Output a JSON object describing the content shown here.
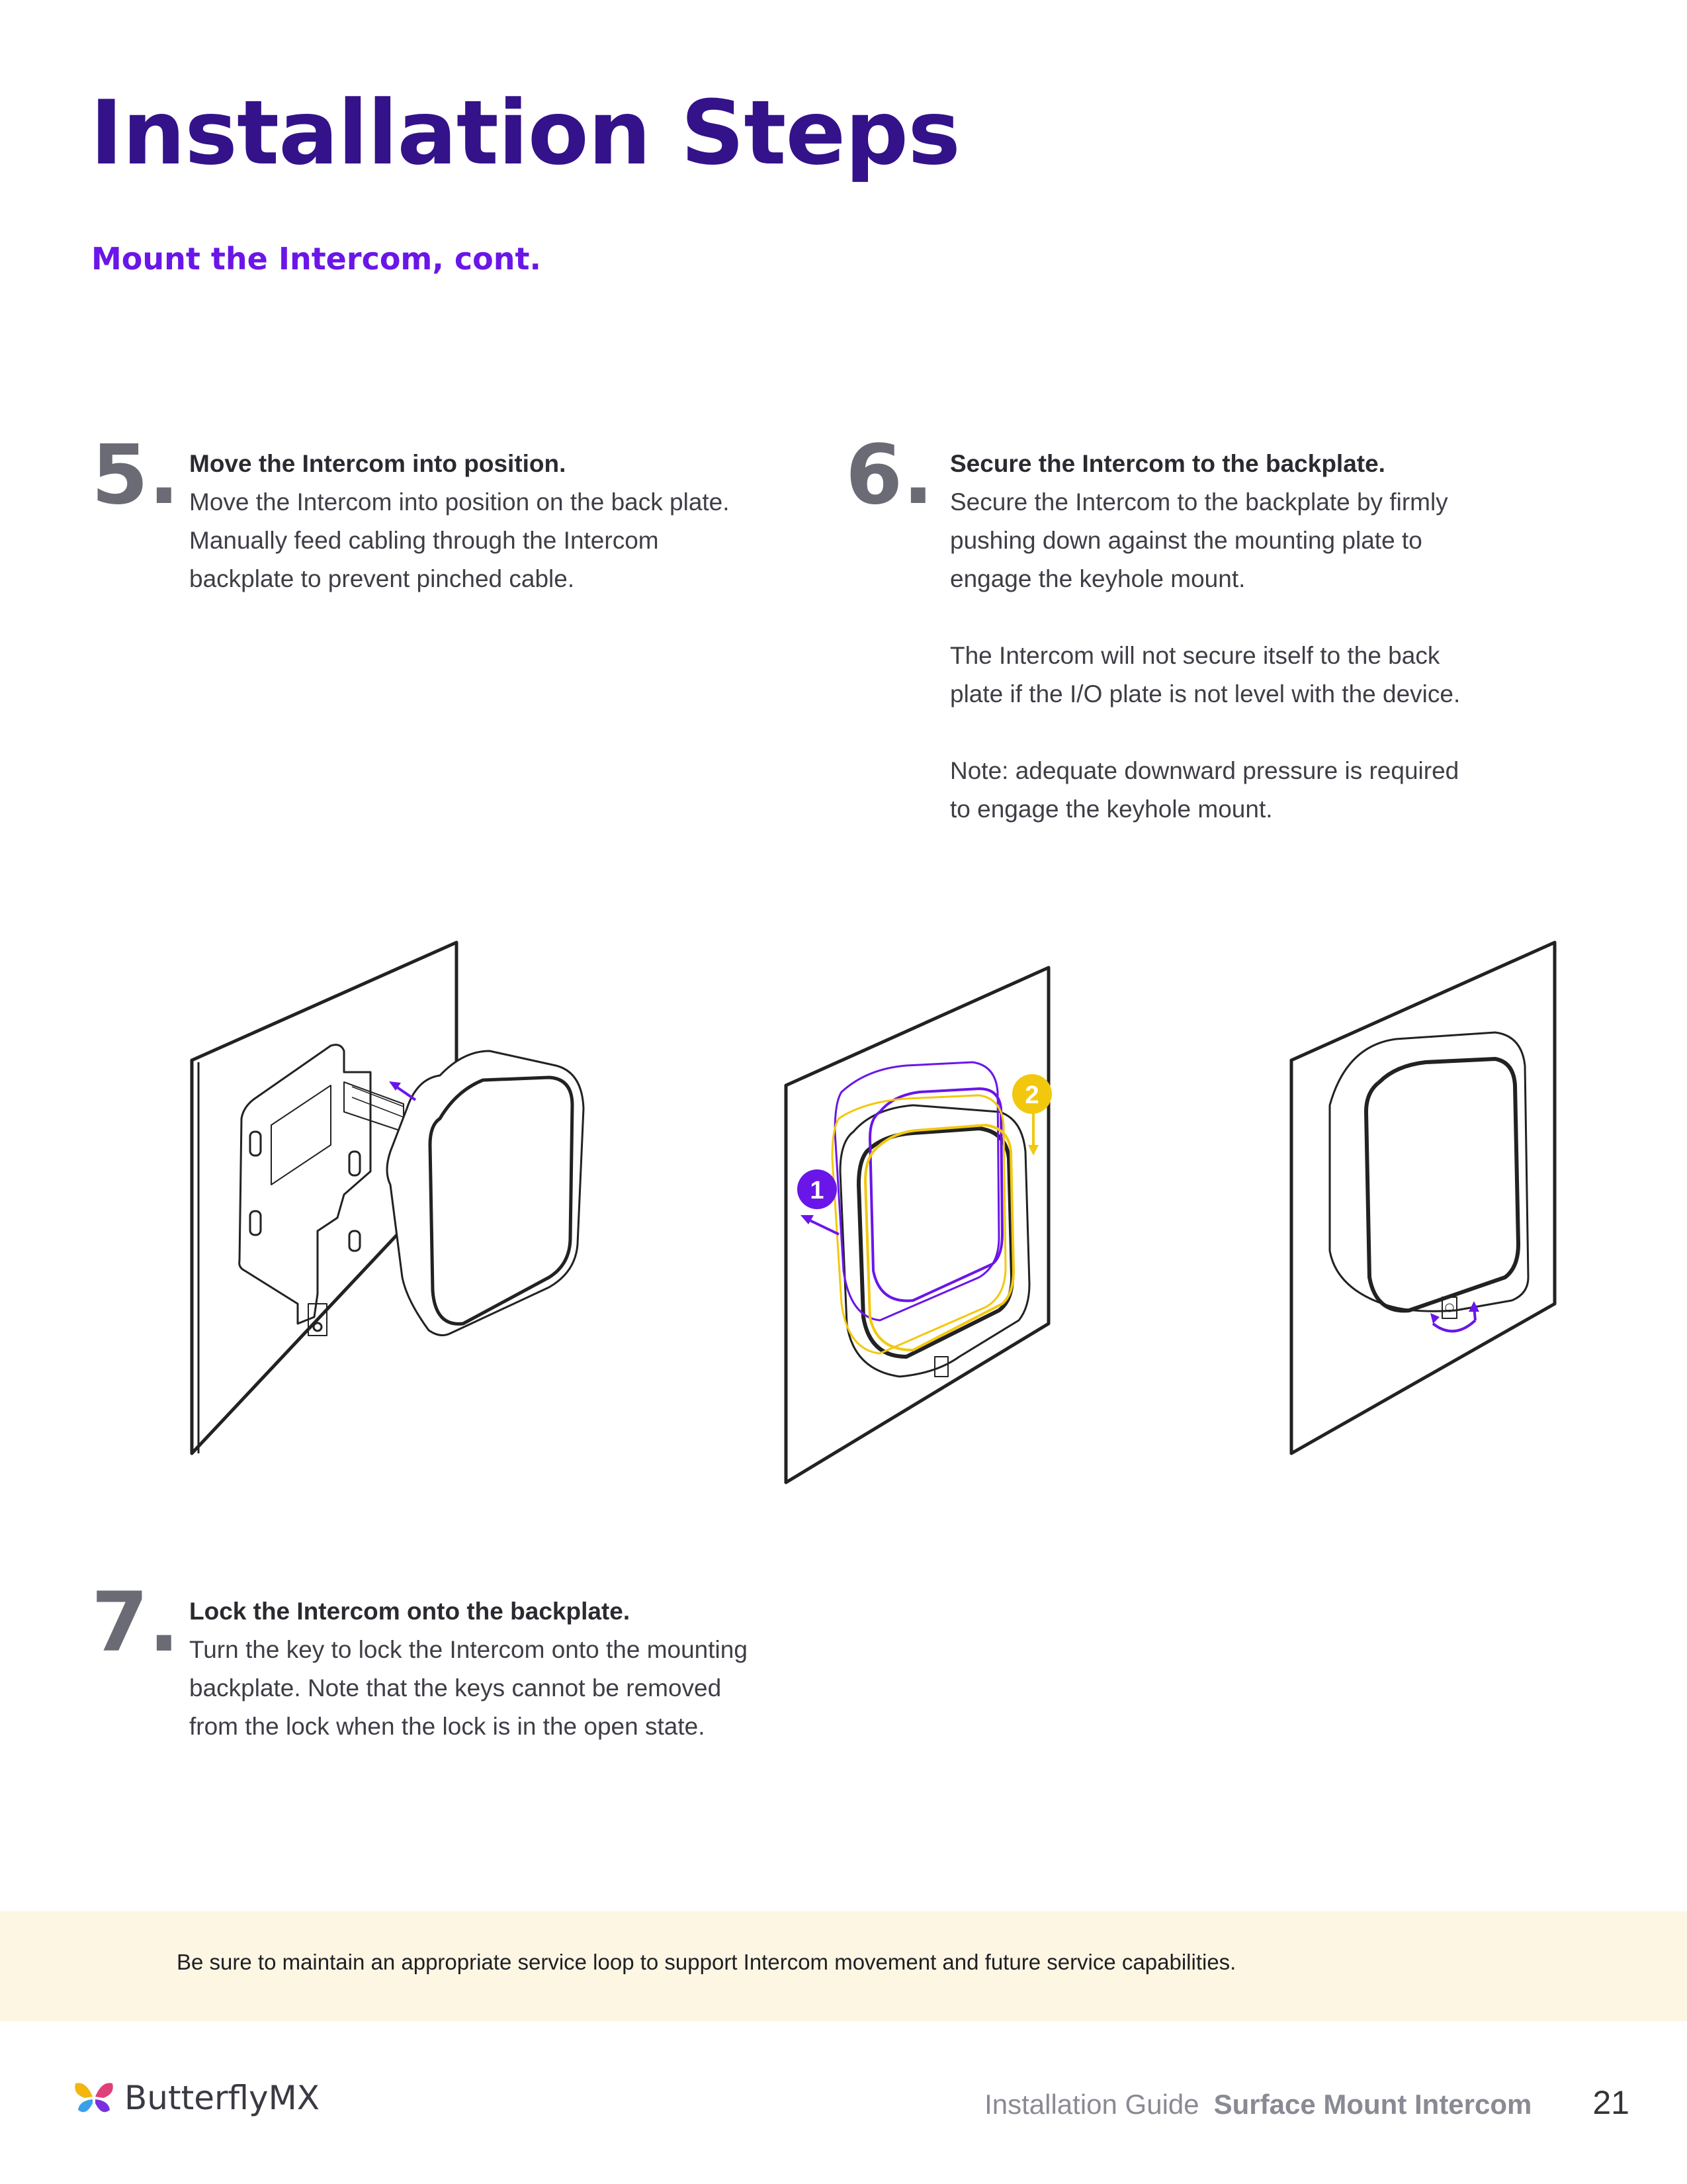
{
  "header": {
    "title": "Installation Steps",
    "subtitle": "Mount the Intercom, cont."
  },
  "steps": [
    {
      "number": "5.",
      "title": "Move the Intercom into position.",
      "paragraphs": [
        "Move the Intercom into position on the back plate. Manually feed cabling through the Intercom backplate to prevent pinched cable."
      ]
    },
    {
      "number": "6.",
      "title": "Secure the Intercom to the backplate.",
      "paragraphs": [
        "Secure the Intercom to the backplate by firmly pushing down against the mounting plate to engage the keyhole mount.",
        "The Intercom will not secure itself to the back plate if the I/O plate is not level with the device.",
        "Note: adequate downward pressure is required to engage the keyhole mount."
      ]
    },
    {
      "number": "7.",
      "title": "Lock the Intercom onto the backplate.",
      "paragraphs": [
        "Turn the key to lock the Intercom onto the mounting backplate. Note that the keys cannot be removed from the lock when the lock is in the open state."
      ]
    }
  ],
  "illustrations": {
    "badge_1": "1",
    "badge_2": "2",
    "colors": {
      "purple": "#6a16e8",
      "yellow": "#f2c80f"
    }
  },
  "banner": {
    "text": "Be sure to maintain an appropriate service loop to support Intercom movement and future service capabilities."
  },
  "footer": {
    "brand": "ButterflyMX",
    "guide_label": "Installation Guide",
    "product_label": "Surface Mount Intercom",
    "page_number": "21"
  }
}
